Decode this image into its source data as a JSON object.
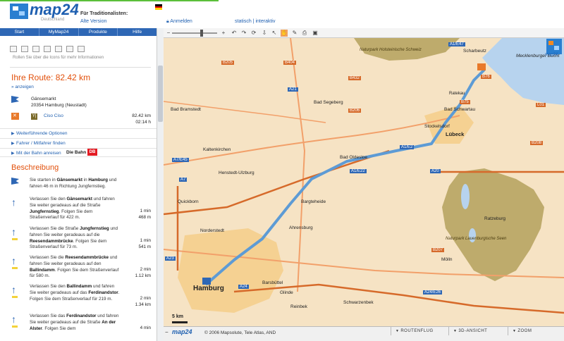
{
  "header": {
    "logo_name": "map24",
    "logo_sub": "Deutschland",
    "traditional_label": "Für Traditionalisten:",
    "old_version_link": "Alte Version",
    "login": "Anmelden",
    "mode_static": "statisch",
    "mode_sep": " | ",
    "mode_interactive": "interaktiv"
  },
  "nav": {
    "items": [
      "Start",
      "MyMap24",
      "Produkte",
      "Hilfe"
    ]
  },
  "sidebar": {
    "tool_hint": "Rollen Sie über die Icons für mehr Informationen",
    "route_title": "Ihre Route: 82.42 km",
    "anzeigen": "» anzeigen",
    "start_line1": "Gänsemarkt",
    "start_line2": "20354 Hamburg (Neustadt)",
    "food_icon": "Y|",
    "dest_name": "Ciso Ciso",
    "dist_total": "82.42 km",
    "time_total": "02:14 h",
    "options": [
      "Weiterführende Optionen",
      "Fahrer / Mitfahrer finden",
      "Mit der Bahn anreisen"
    ],
    "db_text": "Die Bahn",
    "db_logo": "DB",
    "desc_title": "Beschreibung",
    "steps": [
      {
        "pre": "Sie starten in ",
        "b1": "Gänsemarkt",
        "mid1": " in ",
        "b2": "Hamburg",
        "post": " und fahren 46 m in Richtung Jungfernstieg.",
        "d1": "",
        "d2": ""
      },
      {
        "pre": "Verlassen Sie den ",
        "b1": "Gänsemarkt",
        "mid1": " und fahren Sie weiter geradeaus auf die Straße ",
        "b2": "Jungfernstieg",
        "post": ". Folgen Sie dem Straßenverlauf für 422 m.",
        "d1": "1 min",
        "d2": "468 m"
      },
      {
        "pre": "Verlassen Sie die Straße ",
        "b1": "Jungfernstieg",
        "mid1": " und fahren Sie weiter geradeaus auf die ",
        "b2": "Reesendammbrücke",
        "post": ". Folgen Sie dem Straßenverlauf für 73 m.",
        "d1": "1 min",
        "d2": "541 m"
      },
      {
        "pre": "Verlassen Sie die ",
        "b1": "Reesendammbrücke",
        "mid1": " und fahren Sie weiter geradeaus auf den ",
        "b2": "Ballindamm",
        "post": ". Folgen Sie dem Straßenverlauf für 580 m.",
        "d1": "2 min",
        "d2": "1.12 km"
      },
      {
        "pre": "Verlassen Sie den ",
        "b1": "Ballindamm",
        "mid1": " und fahren Sie weiter geradeaus auf das ",
        "b2": "Ferdinandstor",
        "post": ". Folgen Sie dem Straßenverlauf für 219 m.",
        "d1": "2 min",
        "d2": "1.34 km"
      },
      {
        "pre": "Verlassen Sie das ",
        "b1": "Ferdinandstor",
        "mid1": " und fahren Sie weiter geradeaus auf die Straße ",
        "b2": "An der Alster",
        "post": ". Folgen Sie dem",
        "d1": "4 min",
        "d2": ""
      }
    ]
  },
  "map": {
    "places": [
      "Scharbeutz",
      "Mecklenburger Bucht",
      "Bad Bramstedt",
      "Bad Segeberg",
      "Bad Schwartau",
      "Stockelsdorf",
      "Lübeck",
      "Kaltenkirchen",
      "Henstedt-Ulzburg",
      "Bad Oldesloe",
      "Bargteheide",
      "Quickborn",
      "Norderstedt",
      "Ahrensburg",
      "Ratzeburg",
      "Mölln",
      "Hamburg",
      "Barsbüttel",
      "Glinde",
      "Reinbek",
      "Schwarzenbek",
      "Ratekau"
    ],
    "roads": [
      "A1/E47",
      "A21",
      "B432",
      "B206",
      "B404",
      "B205",
      "A7/E45",
      "A7",
      "A1/E22",
      "A1/E2",
      "A20",
      "B75",
      "B76",
      "L01",
      "B207",
      "A23",
      "A24",
      "A24/E26",
      "B208"
    ],
    "parks": [
      "Naturpark Holsteinische Schweiz",
      "Naturpark Lauenburgische Seen"
    ],
    "scale": "5 km",
    "corner_label": "map24",
    "colors": {
      "land": "#f6e3c4",
      "water": "#b7d3ee",
      "park": "#b8a463",
      "route": "#5d9bd5",
      "road": "#f2a06a",
      "highway": "#d66a2a",
      "city": "#f5c97e"
    }
  },
  "bottom": {
    "zoomout": "−",
    "logo": "map24",
    "copyright": "© 2006 Mapsolute, Tele Atlas, AND",
    "buttons": [
      "ROUTENFLUG",
      "3D-ANSICHT",
      "ZOOM"
    ]
  }
}
